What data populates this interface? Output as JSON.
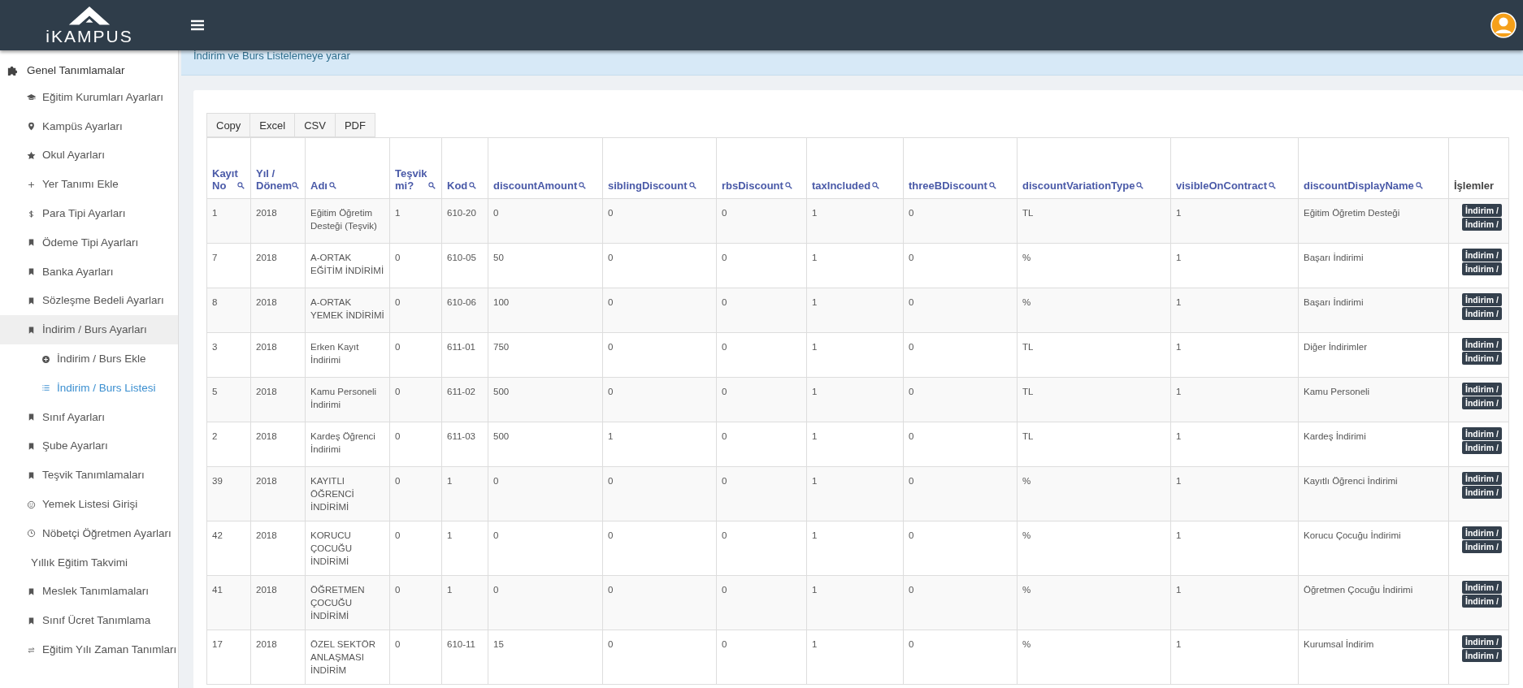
{
  "header": {
    "logo_text": "iKAMPUS"
  },
  "sidebar": {
    "section": {
      "label": "Genel Tanımlamalar",
      "items": [
        {
          "label": "Eğitim Kurumları Ayarları",
          "selected": false
        },
        {
          "label": "Kampüs Ayarları",
          "selected": false
        },
        {
          "label": "Okul Ayarları",
          "selected": false
        },
        {
          "label": "Yer Tanımı Ekle",
          "selected": false
        },
        {
          "label": "Para Tipi Ayarları",
          "selected": false
        },
        {
          "label": "Ödeme Tipi Ayarları",
          "selected": false
        },
        {
          "label": "Banka Ayarları",
          "selected": false
        },
        {
          "label": "Sözleşme Bedeli Ayarları",
          "selected": false
        },
        {
          "label": "İndirim / Burs Ayarları",
          "selected": true,
          "children": [
            {
              "label": "İndirim / Burs Ekle",
              "selected": false
            },
            {
              "label": "İndirim / Burs Listesi",
              "selected": true
            }
          ]
        },
        {
          "label": "Sınıf Ayarları",
          "selected": false
        },
        {
          "label": "Şube Ayarları",
          "selected": false
        },
        {
          "label": "Teşvik Tanımlamaları",
          "selected": false
        },
        {
          "label": "Yemek Listesi Girişi",
          "selected": false
        },
        {
          "label": "Nöbetçi Öğretmen Ayarları",
          "selected": false
        },
        {
          "label": "Yıllık Eğitim Takvimi",
          "selected": false
        },
        {
          "label": "Meslek Tanımlamaları",
          "selected": false
        },
        {
          "label": "Sınıf Ücret Tanımlama",
          "selected": false
        },
        {
          "label": "Eğitim Yılı Zaman Tanımları",
          "selected": false
        }
      ]
    }
  },
  "info": "İndirim ve Burs Listelemeye yarar",
  "export_buttons": [
    "Copy",
    "Excel",
    "CSV",
    "PDF"
  ],
  "table": {
    "columns": [
      {
        "label": "Kayıt No",
        "searchable": true
      },
      {
        "label": "Yıl / Dönem",
        "searchable": true
      },
      {
        "label": "Adı",
        "searchable": true
      },
      {
        "label": "Teşvik mi?",
        "searchable": true
      },
      {
        "label": "Kod",
        "searchable": true
      },
      {
        "label": "discountAmount",
        "searchable": true
      },
      {
        "label": "siblingDiscount",
        "searchable": true
      },
      {
        "label": "rbsDiscount",
        "searchable": true
      },
      {
        "label": "taxIncluded",
        "searchable": true
      },
      {
        "label": "threeBDiscount",
        "searchable": true
      },
      {
        "label": "discountVariationType",
        "searchable": true
      },
      {
        "label": "visibleOnContract",
        "searchable": true
      },
      {
        "label": "discountDisplayName",
        "searchable": true
      },
      {
        "label": "İşlemler",
        "searchable": false
      }
    ],
    "rows": [
      {
        "cells": [
          "1",
          "2018",
          "Eğitim Öğretim Desteği (Teşvik)",
          "1",
          "610-20",
          "0",
          "0",
          "0",
          "1",
          "0",
          "TL",
          "1",
          "Eğitim Öğretim Desteği"
        ],
        "actions": [
          "İndirim /",
          "İndirim /"
        ]
      },
      {
        "cells": [
          "7",
          "2018",
          "A-ORTAK EĞİTİM İNDİRİMİ",
          "0",
          "610-05",
          "50",
          "0",
          "0",
          "1",
          "0",
          "%",
          "1",
          "Başarı İndirimi"
        ],
        "actions": [
          "İndirim /",
          "İndirim /"
        ]
      },
      {
        "cells": [
          "8",
          "2018",
          "A-ORTAK YEMEK İNDİRİMİ",
          "0",
          "610-06",
          "100",
          "0",
          "0",
          "1",
          "0",
          "%",
          "1",
          "Başarı İndirimi"
        ],
        "actions": [
          "İndirim /",
          "İndirim /"
        ]
      },
      {
        "cells": [
          "3",
          "2018",
          "Erken Kayıt İndirimi",
          "0",
          "611-01",
          "750",
          "0",
          "0",
          "1",
          "0",
          "TL",
          "1",
          "Diğer İndirimler"
        ],
        "actions": [
          "İndirim /",
          "İndirim /"
        ]
      },
      {
        "cells": [
          "5",
          "2018",
          "Kamu Personeli İndirimi",
          "0",
          "611-02",
          "500",
          "0",
          "0",
          "1",
          "0",
          "TL",
          "1",
          "Kamu Personeli"
        ],
        "actions": [
          "İndirim /",
          "İndirim /"
        ]
      },
      {
        "cells": [
          "2",
          "2018",
          "Kardeş Öğrenci İndirimi",
          "0",
          "611-03",
          "500",
          "1",
          "0",
          "1",
          "0",
          "TL",
          "1",
          "Kardeş İndirimi"
        ],
        "actions": [
          "İndirim /",
          "İndirim /"
        ]
      },
      {
        "cells": [
          "39",
          "2018",
          "KAYITLI ÖĞRENCİ İNDİRİMİ",
          "0",
          "1",
          "0",
          "0",
          "0",
          "1",
          "0",
          "%",
          "1",
          "Kayıtlı Öğrenci İndirimi"
        ],
        "actions": [
          "İndirim /",
          "İndirim /"
        ]
      },
      {
        "cells": [
          "42",
          "2018",
          "KORUCU ÇOCUĞU İNDİRİMİ",
          "0",
          "1",
          "0",
          "0",
          "0",
          "1",
          "0",
          "%",
          "1",
          "Korucu Çocuğu İndirimi"
        ],
        "actions": [
          "İndirim /",
          "İndirim /"
        ]
      },
      {
        "cells": [
          "41",
          "2018",
          "ÖĞRETMEN ÇOCUĞU İNDİRİMİ",
          "0",
          "1",
          "0",
          "0",
          "0",
          "1",
          "0",
          "%",
          "1",
          "Öğretmen Çocuğu İndirimi"
        ],
        "actions": [
          "İndirim /",
          "İndirim /"
        ]
      },
      {
        "cells": [
          "17",
          "2018",
          "ÖZEL SEKTÖR ANLAŞMASI İNDİRİM",
          "0",
          "610-11",
          "15",
          "0",
          "0",
          "1",
          "0",
          "%",
          "1",
          "Kurumsal İndirim"
        ],
        "actions": [
          "İndirim /",
          "İndirim /"
        ]
      }
    ]
  }
}
